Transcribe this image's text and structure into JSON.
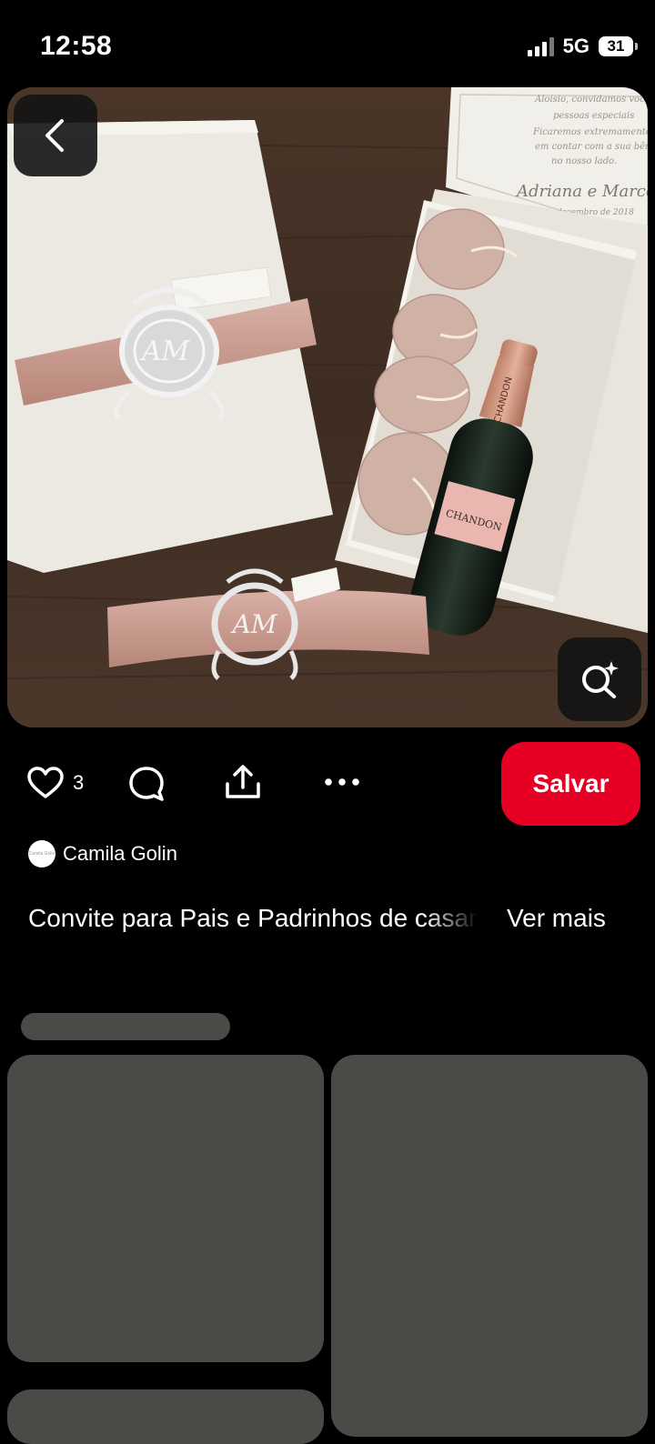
{
  "status_bar": {
    "time": "12:58",
    "network": "5G",
    "battery": "31"
  },
  "pin": {
    "image_alt": "Wedding invitation box with rose ribbon, AM monogram and Chandon bottle",
    "likes": "3",
    "save_label": "Salvar",
    "author": "Camila Golin",
    "avatar_text": "Camila Golin",
    "description": "Convite para Pais e Padrinhos de casamento",
    "see_more": "Ver mais"
  },
  "icons": {
    "back": "chevron-left-icon",
    "lens": "visual-search-icon",
    "like": "heart-icon",
    "comment": "comment-icon",
    "share": "share-icon",
    "more": "more-icon"
  },
  "colors": {
    "save": "#e60023",
    "skeleton": "#4a4a46"
  }
}
